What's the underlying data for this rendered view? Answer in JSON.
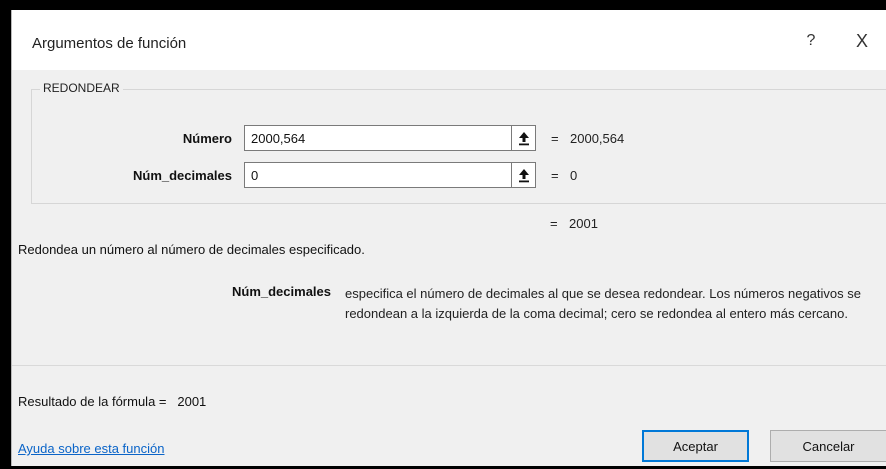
{
  "dialog": {
    "title": "Argumentos de función",
    "help_glyph": "?",
    "close_glyph": "X"
  },
  "function": {
    "name": "REDONDEAR",
    "args": [
      {
        "label": "Número",
        "value": "2000,564",
        "result": "2000,564"
      },
      {
        "label": "Núm_decimales",
        "value": "0",
        "result": "0"
      }
    ],
    "equals": "=",
    "result": "2001",
    "description": "Redondea un número al número de decimales especificado.",
    "param_help": {
      "name": "Núm_decimales",
      "text": "especifica el número de decimales al que se desea redondear. Los números negativos se redondean a la izquierda de la coma decimal; cero se redondea al entero más cercano."
    }
  },
  "footer": {
    "formula_label": "Resultado de la fórmula =",
    "formula_value": "2001",
    "help_link": "Ayuda sobre esta función",
    "ok_label": "Aceptar",
    "cancel_label": "Cancelar"
  },
  "icons": {
    "range_picker": "collapse-dialog-arrow-icon"
  }
}
